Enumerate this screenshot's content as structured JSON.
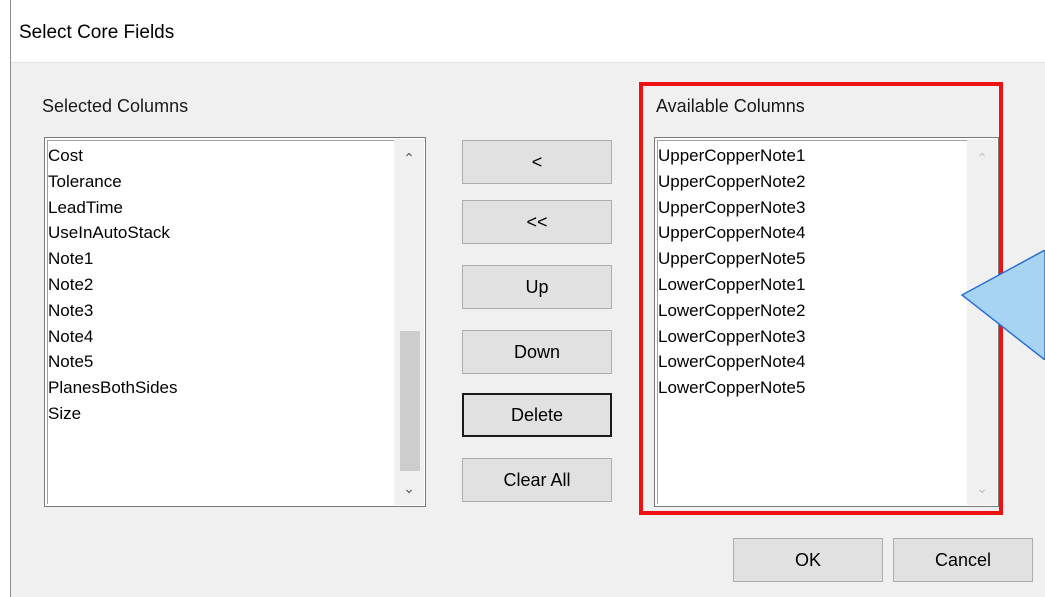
{
  "dialog": {
    "title": "Select Core Fields"
  },
  "selected": {
    "label": "Selected Columns",
    "items": [
      "Cost",
      "Tolerance",
      "LeadTime",
      "UseInAutoStack",
      "Note1",
      "Note2",
      "Note3",
      "Note4",
      "Note5",
      "PlanesBothSides",
      "Size"
    ]
  },
  "available": {
    "label": "Available Columns",
    "items": [
      "UpperCopperNote1",
      "UpperCopperNote2",
      "UpperCopperNote3",
      "UpperCopperNote4",
      "UpperCopperNote5",
      "LowerCopperNote1",
      "LowerCopperNote2",
      "LowerCopperNote3",
      "LowerCopperNote4",
      "LowerCopperNote5"
    ]
  },
  "buttons": {
    "move_left": "<",
    "move_all_left": "<<",
    "up": "Up",
    "down": "Down",
    "delete": "Delete",
    "clear_all": "Clear All",
    "ok": "OK",
    "cancel": "Cancel"
  },
  "colors": {
    "highlight": "#ee1111",
    "callout_fill": "#a8d4f4",
    "callout_stroke": "#2a6fd6"
  },
  "icons": {
    "scroll_up": "chevron-up-icon",
    "scroll_down": "chevron-down-icon"
  }
}
